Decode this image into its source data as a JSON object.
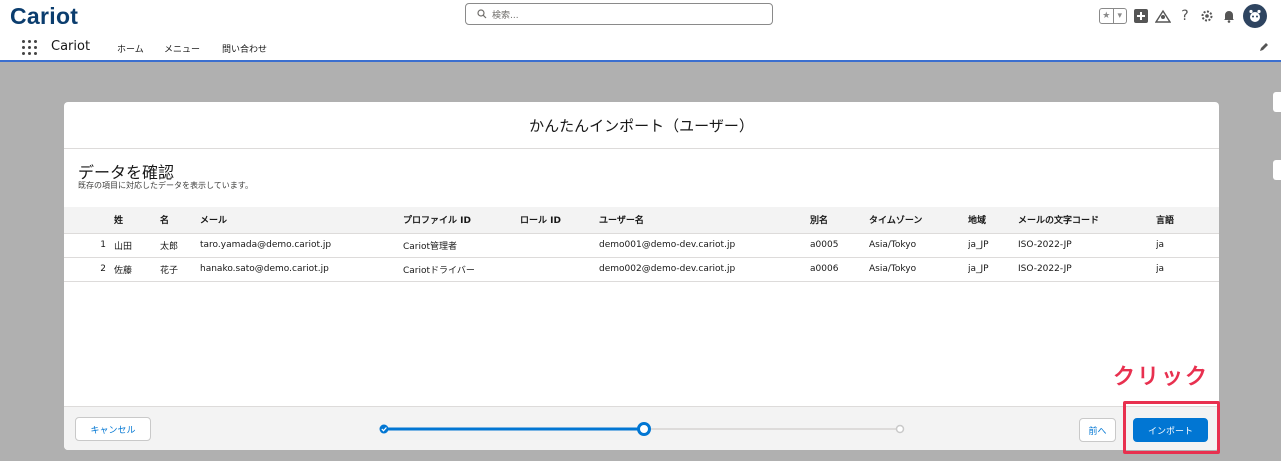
{
  "header": {
    "logo": "Cariot",
    "search_placeholder": "検索..."
  },
  "nav": {
    "app_name": "Cariot",
    "items": [
      "ホーム",
      "メニュー",
      "問い合わせ"
    ]
  },
  "modal": {
    "title": "かんたんインポート（ユーザー）",
    "section_title": "データを確認",
    "section_subtitle": "既存の項目に対応したデータを表示しています。",
    "columns": [
      "",
      "姓",
      "名",
      "メール",
      "プロファイル ID",
      "ロール ID",
      "ユーザー名",
      "別名",
      "タイムゾーン",
      "地域",
      "メールの文字コード",
      "言語"
    ],
    "rows": [
      [
        "1",
        "山田",
        "太郎",
        "taro.yamada@demo.cariot.jp",
        "Cariot管理者",
        "",
        "demo001@demo-dev.cariot.jp",
        "a0005",
        "Asia/Tokyo",
        "ja_JP",
        "ISO-2022-JP",
        "ja"
      ],
      [
        "2",
        "佐藤",
        "花子",
        "hanako.sato@demo.cariot.jp",
        "Cariotドライバー",
        "",
        "demo002@demo-dev.cariot.jp",
        "a0006",
        "Asia/Tokyo",
        "ja_JP",
        "ISO-2022-JP",
        "ja"
      ]
    ],
    "cancel_label": "キャンセル",
    "prev_label": "前へ",
    "import_label": "インポート",
    "progress": {
      "total_steps": 3,
      "current_step": 2
    }
  },
  "annotation": {
    "callout": "クリック",
    "color": "#e8304f"
  },
  "colors": {
    "brand": "#0176d3",
    "logo": "#0b3d6e"
  }
}
